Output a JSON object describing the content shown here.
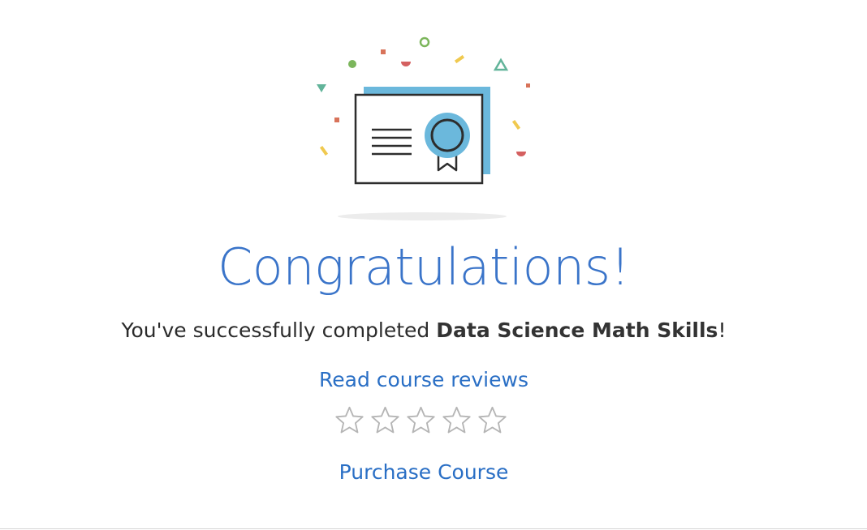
{
  "completion": {
    "title": "Congratulations!",
    "message_prefix": "You've successfully completed ",
    "course_name": "Data Science Math Skills",
    "message_suffix": "!"
  },
  "actions": {
    "reviews_link": "Read course reviews",
    "purchase_link": "Purchase Course"
  },
  "rating": {
    "max_stars": 5,
    "selected": 0
  },
  "icons": {
    "illustration": "certificate-with-confetti-icon",
    "rating_star": "star-outline-icon"
  },
  "colors": {
    "title": "#3a74c9",
    "link": "#2a6fc5",
    "text": "#2b2b2b",
    "certificate_accent": "#6bb8dc",
    "star_outline": "#b5b5b5"
  }
}
